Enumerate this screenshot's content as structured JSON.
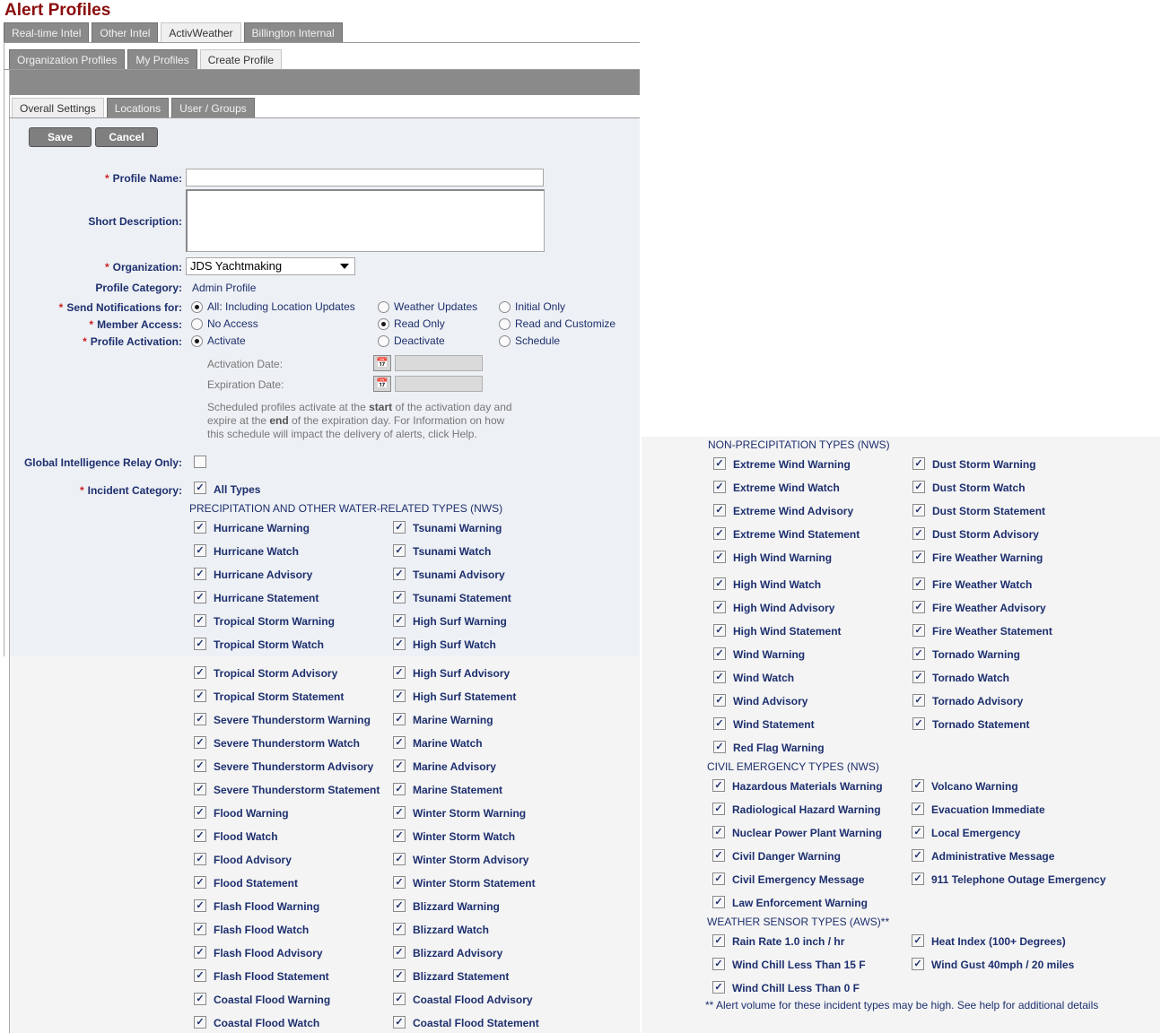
{
  "page_title": "Alert Profiles",
  "tabs_top": [
    "Real-time Intel",
    "Other Intel",
    "ActivWeather",
    "Billington Internal"
  ],
  "tabs_top_active": 2,
  "tabs_second": [
    "Organization Profiles",
    "My Profiles",
    "Create Profile"
  ],
  "tabs_second_active": 2,
  "tabs_third": [
    "Overall Settings",
    "Locations",
    "User / Groups"
  ],
  "tabs_third_active": 0,
  "buttons": {
    "save": "Save",
    "cancel": "Cancel"
  },
  "form": {
    "profile_name_label": "Profile Name:",
    "profile_name_value": "",
    "short_desc_label": "Short Description:",
    "short_desc_value": "",
    "organization_label": "Organization:",
    "organization_value": "JDS Yachtmaking",
    "category_label": "Profile Category:",
    "category_value": "Admin Profile",
    "send_label": "Send Notifications for:",
    "send_options": [
      "All: Including Location Updates",
      "Weather Updates",
      "Initial Only"
    ],
    "send_selected": 0,
    "member_label": "Member Access:",
    "member_options": [
      "No Access",
      "Read Only",
      "Read and Customize"
    ],
    "member_selected": 1,
    "activation_label": "Profile Activation:",
    "activation_options": [
      "Activate",
      "Deactivate",
      "Schedule"
    ],
    "activation_selected": 0,
    "activation_date_label": "Activation Date:",
    "expiration_date_label": "Expiration Date:",
    "help_prefix": "Scheduled profiles activate at the ",
    "help_start": "start",
    "help_mid": " of the activation day and expire at the ",
    "help_end": "end",
    "help_suffix": " of the expiration day. For Information on how this schedule will impact the delivery of alerts, click Help.",
    "relay_label": "Global Intelligence Relay Only:",
    "incident_label": "Incident Category:",
    "all_types_label": "All Types"
  },
  "sections": {
    "precip": "PRECIPITATION AND OTHER WATER-RELATED TYPES (NWS)",
    "nonprecip": "NON-PRECIPITATION TYPES (NWS)",
    "civil": "CIVIL EMERGENCY TYPES (NWS)",
    "sensor": "WEATHER SENSOR TYPES (AWS)**"
  },
  "precip_col1": [
    "Hurricane Warning",
    "Hurricane Watch",
    "Hurricane Advisory",
    "Hurricane Statement",
    "Tropical Storm Warning",
    "Tropical Storm Watch",
    "Tropical Storm Advisory",
    "Tropical Storm Statement",
    "Severe Thunderstorm Warning",
    "Severe Thunderstorm Watch",
    "Severe Thunderstorm Advisory",
    "Severe Thunderstorm Statement",
    "Flood Warning",
    "Flood Watch",
    "Flood Advisory",
    "Flood Statement",
    "Flash Flood Warning",
    "Flash Flood Watch",
    "Flash Flood Advisory",
    "Flash Flood Statement",
    "Coastal Flood Warning",
    "Coastal Flood Watch"
  ],
  "precip_col2": [
    "Tsunami Warning",
    "Tsunami Watch",
    "Tsunami Advisory",
    "Tsunami Statement",
    "High Surf Warning",
    "High Surf Watch",
    "High Surf Advisory",
    "High Surf Statement",
    "Marine Warning",
    "Marine Watch",
    "Marine Advisory",
    "Marine Statement",
    "Winter Storm Warning",
    "Winter Storm Watch",
    "Winter Storm Advisory",
    "Winter Storm Statement",
    "Blizzard Warning",
    "Blizzard Watch",
    "Blizzard Advisory",
    "Blizzard Statement",
    "Coastal Flood Advisory",
    "Coastal Flood Statement"
  ],
  "nonprecip_col1": [
    "Extreme Wind Warning",
    "Extreme Wind Watch",
    "Extreme Wind Advisory",
    "Extreme Wind Statement",
    "High Wind Warning",
    "High Wind Watch",
    "High Wind Advisory",
    "High Wind Statement",
    "Wind Warning",
    "Wind Watch",
    "Wind Advisory",
    "Wind Statement",
    "Red Flag Warning"
  ],
  "nonprecip_col2": [
    "Dust Storm Warning",
    "Dust Storm Watch",
    "Dust Storm Statement",
    "Dust Storm Advisory",
    "Fire Weather Warning",
    "Fire Weather Watch",
    "Fire Weather Advisory",
    "Fire Weather Statement",
    "Tornado Warning",
    "Tornado Watch",
    "Tornado Advisory",
    "Tornado Statement"
  ],
  "civil_col1": [
    "Hazardous Materials Warning",
    "Radiological Hazard Warning",
    "Nuclear Power Plant Warning",
    "Civil Danger Warning",
    "Civil Emergency Message",
    "Law Enforcement Warning"
  ],
  "civil_col2": [
    "Volcano Warning",
    "Evacuation Immediate",
    "Local Emergency",
    "Administrative Message",
    "911 Telephone Outage Emergency"
  ],
  "sensor_col1": [
    "Rain Rate 1.0 inch / hr",
    "Wind Chill Less Than 15 F",
    "Wind Chill Less Than 0 F"
  ],
  "sensor_col2": [
    "Heat Index (100+ Degrees)",
    "Wind Gust 40mph / 20 miles"
  ],
  "sensor_note": "** Alert volume for these incident types may be high. See help for additional details",
  "icons": {
    "check": "✓",
    "calendar": "calendar-icon"
  }
}
